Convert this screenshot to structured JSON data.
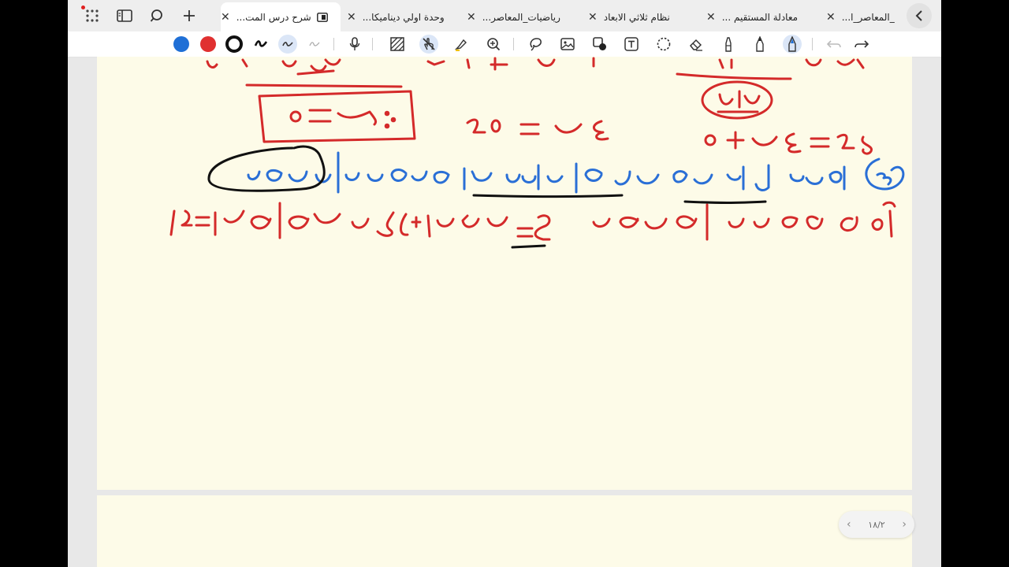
{
  "tabs": [
    {
      "title": "_المعاصر_ا..."
    },
    {
      "title": "معادلة المستقيم ..."
    },
    {
      "title": "نظام ثلاثي الابعاد"
    },
    {
      "title": "رياضيات_المعاصر..."
    },
    {
      "title": "وحدة اولي ديناميكا..."
    },
    {
      "title": "شرح درس المت..."
    }
  ],
  "active_tab": "شرح درس المت...",
  "toolbar": {
    "colors": [
      "#1f6fd6",
      "#e03030",
      "#111111"
    ],
    "icons": [
      "pen-icon",
      "pen-alt-icon",
      "pen-light-icon",
      "microphone-icon",
      "pattern-icon",
      "touch-disabled-icon",
      "highlighter-icon",
      "zoom-icon",
      "lasso-icon",
      "image-icon",
      "shapes-icon",
      "text-icon",
      "select-circle-icon",
      "eraser-icon",
      "marker-icon",
      "pencil-icon",
      "fountain-pen-icon",
      "undo-icon",
      "redo-icon"
    ]
  },
  "pager": {
    "label": "١٨/٢",
    "prev": "‹",
    "next": "›"
  },
  "close_glyph": "✕"
}
